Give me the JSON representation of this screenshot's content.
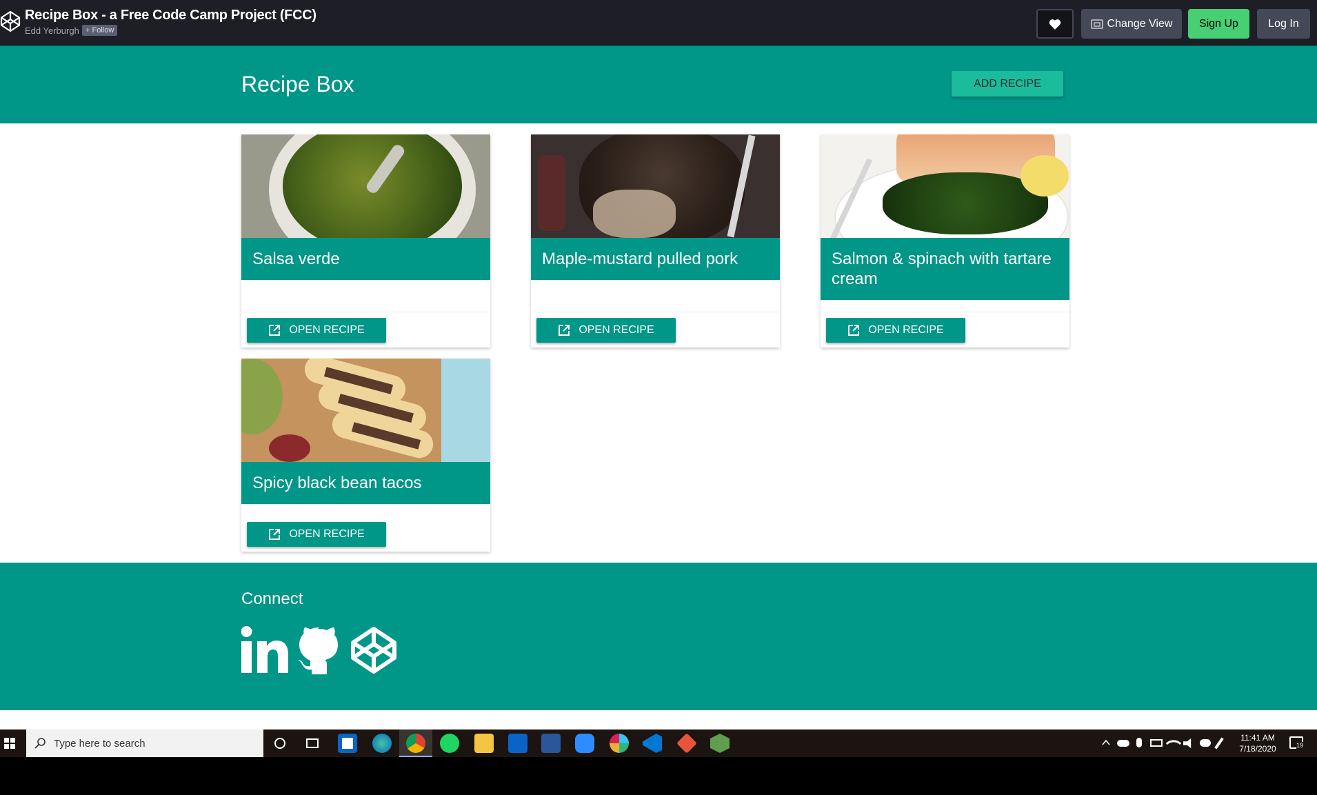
{
  "codepen": {
    "title": "Recipe Box - a Free Code Camp Project (FCC)",
    "author": "Edd Yerburgh",
    "follow_label": "+ Follow",
    "change_view_label": "Change View",
    "signup_label": "Sign Up",
    "login_label": "Log In"
  },
  "app": {
    "title": "Recipe Box",
    "add_recipe_label": "ADD RECIPE",
    "open_recipe_label": "OPEN RECIPE",
    "recipes": [
      {
        "title": "Salsa verde"
      },
      {
        "title": "Maple-mustard pulled pork"
      },
      {
        "title": "Salmon & spinach with tartare cream"
      },
      {
        "title": "Spicy black bean tacos"
      }
    ]
  },
  "footer": {
    "connect_label": "Connect",
    "social_icons": [
      "linkedin-icon",
      "github-icon",
      "codepen-icon"
    ]
  },
  "taskbar": {
    "search_placeholder": "Type here to search",
    "time": "11:41 AM",
    "date": "7/18/2020",
    "notification_count": "19"
  },
  "colors": {
    "primary": "#009688",
    "add_button": "#1abc9c",
    "signup": "#47cf73",
    "codepen_bar": "#1e1f26"
  }
}
